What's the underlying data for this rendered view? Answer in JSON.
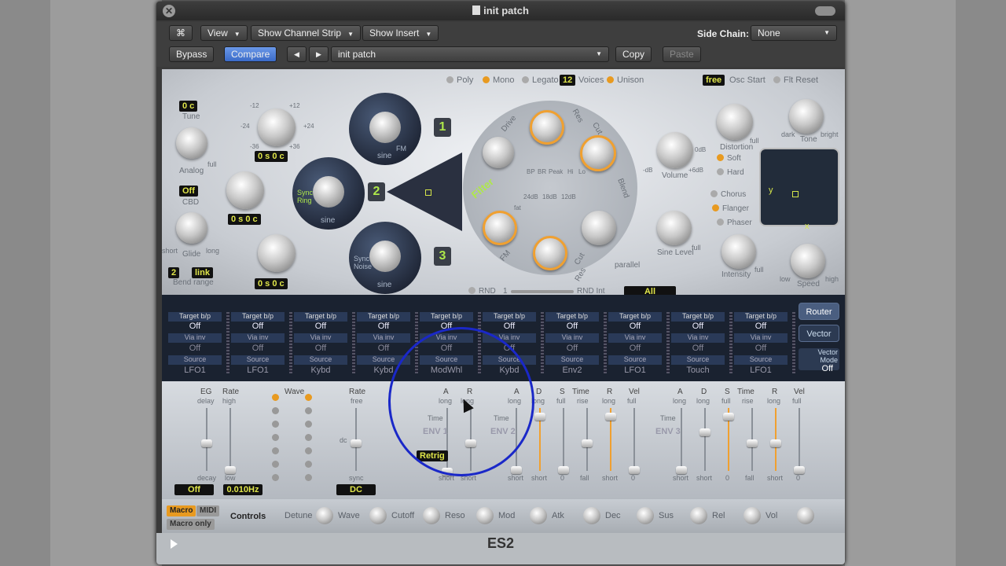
{
  "window": {
    "title": "init patch"
  },
  "toolbar1": {
    "view": "View",
    "show_channel_strip": "Show Channel Strip",
    "show_insert": "Show Insert",
    "side_chain_label": "Side Chain:",
    "side_chain_value": "None"
  },
  "toolbar2": {
    "bypass": "Bypass",
    "compare": "Compare",
    "prev": "◀",
    "next": "▶",
    "preset": "init patch",
    "copy": "Copy",
    "paste": "Paste"
  },
  "voice": {
    "poly": "Poly",
    "mono": "Mono",
    "legato": "Legato",
    "voices_value": "12",
    "voices_label": "Voices",
    "unison": "Unison",
    "free": "free",
    "osc_start": "Osc Start",
    "flt_reset": "Flt Reset"
  },
  "left_panel": {
    "tune_value": "0 c",
    "tune_label": "Tune",
    "analog_label": "Analog",
    "full": "full",
    "cbd_value": "Off",
    "cbd_label": "CBD",
    "glide_label": "Glide",
    "short": "short",
    "long": "long",
    "bend_down": "2",
    "bend_link": "link",
    "bend_range_label": "Bend range"
  },
  "oscillators": [
    {
      "num": "1",
      "wave": "sine",
      "fm": "FM",
      "readout": "0 s   0 c"
    },
    {
      "num": "2",
      "wave": "sine",
      "extra": "Sync Ring",
      "readout": "0 s   0 c"
    },
    {
      "num": "3",
      "wave": "sine",
      "extra": "Sync Noise",
      "readout": "0 s   0 c"
    }
  ],
  "osc_scale": {
    "m12": "-12",
    "p12": "+12",
    "m24": "-24",
    "p24": "+24",
    "m36": "-36",
    "p36": "+36"
  },
  "filter": {
    "label": "Filter",
    "drive": "Drive",
    "res": "Res",
    "cut": "Cut",
    "blend": "Blend",
    "fm": "FM",
    "parallel": "parallel",
    "modes": [
      "BP",
      "BR",
      "Peak",
      "Hi",
      "Lo"
    ],
    "slopes": [
      "24dB",
      "18dB",
      "12dB",
      "fat"
    ],
    "rnd": "RND",
    "rnd_one": "1",
    "rnd_int": "RND Int",
    "rnd_target": "All"
  },
  "right_panel": {
    "volume_label": "Volume",
    "zero_db": "0dB",
    "plus6": "+6dB",
    "minus": "-dB",
    "distortion_label": "Distortion",
    "soft": "Soft",
    "hard": "Hard",
    "full": "full",
    "tone_label": "Tone",
    "dark": "dark",
    "bright": "bright",
    "sine_level_label": "Sine Level",
    "chorus": "Chorus",
    "flanger": "Flanger",
    "phaser": "Phaser",
    "intensity_label": "Intensity",
    "speed_label": "Speed",
    "low": "low",
    "high": "high",
    "y": "y",
    "x": "x"
  },
  "router": {
    "slots": [
      {
        "target": "Off",
        "via": "Off",
        "source": "LFO1"
      },
      {
        "target": "Off",
        "via": "Off",
        "source": "LFO1"
      },
      {
        "target": "Off",
        "via": "Off",
        "source": "Kybd"
      },
      {
        "target": "Off",
        "via": "Off",
        "source": "Kybd"
      },
      {
        "target": "Off",
        "via": "Off",
        "source": "ModWhl"
      },
      {
        "target": "Off",
        "via": "Off",
        "source": "Kybd"
      },
      {
        "target": "Off",
        "via": "Off",
        "source": "Env2"
      },
      {
        "target": "Off",
        "via": "Off",
        "source": "LFO1"
      },
      {
        "target": "Off",
        "via": "Off",
        "source": "Touch"
      },
      {
        "target": "Off",
        "via": "Off",
        "source": "LFO1"
      }
    ],
    "target_hdr": "Target  b/p",
    "via_hdr": "Via   inv",
    "source_hdr": "Source",
    "router_btn": "Router",
    "vector_btn": "Vector",
    "vector_mode_label": "Vector Mode",
    "vector_mode_value": "Off"
  },
  "lfo": {
    "eg": "EG",
    "rate": "Rate",
    "delay": "delay",
    "high": "high",
    "decay": "decay",
    "low": "low",
    "lfo1_value": "Off",
    "lfo1_rate": "0.010Hz",
    "wave": "Wave",
    "rate2": "Rate",
    "free": "free",
    "sync": "sync",
    "lfo2_value": "DC",
    "dc": "dc"
  },
  "env": {
    "a": "A",
    "r": "R",
    "d": "D",
    "s": "S",
    "time": "Time",
    "vel": "Vel",
    "long": "long",
    "short": "short",
    "full": "full",
    "rise": "rise",
    "fall": "fall",
    "zero": "0",
    "retrig": "Retrig",
    "env1": "ENV 1",
    "env2": "ENV 2",
    "env3": "ENV 3"
  },
  "macro": {
    "macro": "Macro",
    "midi": "MIDI",
    "macro_only": "Macro only",
    "controls": "Controls",
    "knobs": [
      "Detune",
      "Wave",
      "Cutoff",
      "Reso",
      "Mod",
      "Atk",
      "Dec",
      "Sus",
      "Rel",
      "Vol"
    ]
  },
  "footer": {
    "name": "ES2"
  }
}
